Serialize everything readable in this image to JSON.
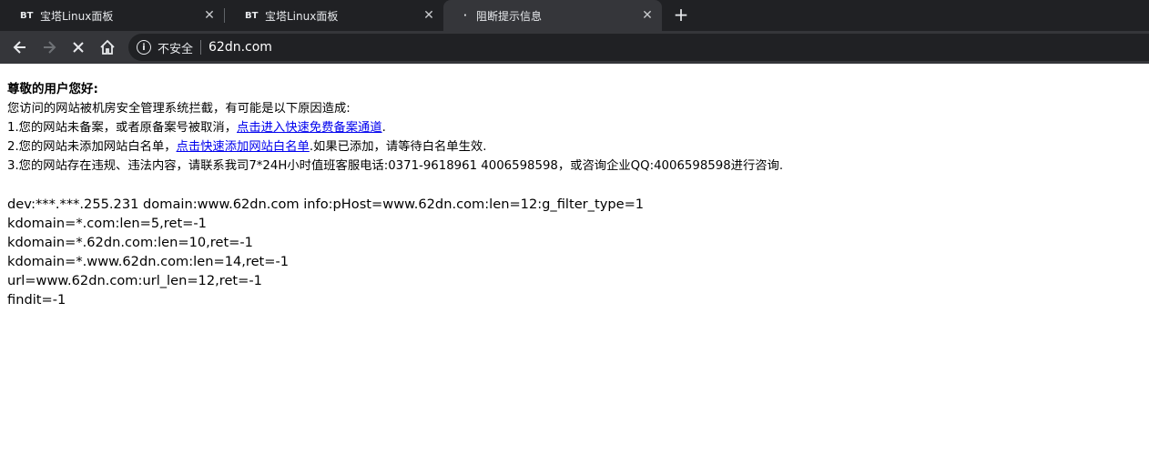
{
  "tabs": [
    {
      "favicon": "BT",
      "title": "宝塔Linux面板"
    },
    {
      "favicon": "BT",
      "title": "宝塔Linux面板"
    },
    {
      "favicon": "·",
      "title": "阻断提示信息"
    }
  ],
  "new_tab_icon": "plus-icon",
  "toolbar": {
    "security_label": "不安全",
    "url": "62dn.com"
  },
  "notice": {
    "greeting": "尊敬的用户您好:",
    "intro": "您访问的网站被机房安全管理系统拦截，有可能是以下原因造成:",
    "reason1_prefix": "1.您的网站未备案，或者原备案号被取消，",
    "reason1_link": "点击进入快速免费备案通道",
    "reason1_suffix": ".",
    "reason2_prefix": "2.您的网站未添加网站白名单，",
    "reason2_link": "点击快速添加网站白名单",
    "reason2_suffix": ".如果已添加，请等待白名单生效.",
    "reason3": "3.您的网站存在违规、违法内容，请联系我司7*24H小时值班客服电话:0371-9618961 4006598598，或咨询企业QQ:4006598598进行咨询."
  },
  "debug_lines": [
    "dev:***.***.255.231 domain:www.62dn.com info:pHost=www.62dn.com:len=12:g_filter_type=1",
    "kdomain=*.com:len=5,ret=-1",
    "kdomain=*.62dn.com:len=10,ret=-1",
    "kdomain=*.www.62dn.com:len=14,ret=-1",
    "url=www.62dn.com:url_len=12,ret=-1",
    "findit=-1"
  ]
}
